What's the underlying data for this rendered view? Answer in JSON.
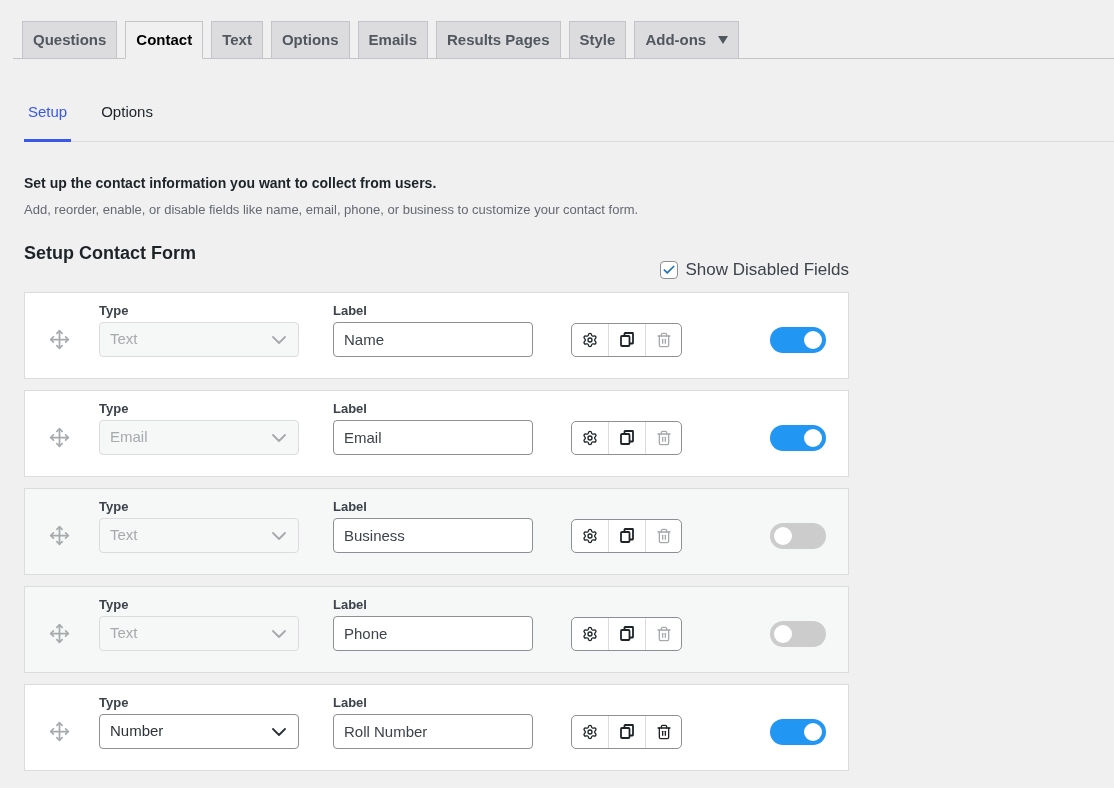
{
  "tabs": [
    {
      "label": "Questions",
      "selected": false,
      "dropdown": false
    },
    {
      "label": "Contact",
      "selected": true,
      "dropdown": false
    },
    {
      "label": "Text",
      "selected": false,
      "dropdown": false
    },
    {
      "label": "Options",
      "selected": false,
      "dropdown": false
    },
    {
      "label": "Emails",
      "selected": false,
      "dropdown": false
    },
    {
      "label": "Results Pages",
      "selected": false,
      "dropdown": false
    },
    {
      "label": "Style",
      "selected": false,
      "dropdown": false
    },
    {
      "label": "Add-ons",
      "selected": false,
      "dropdown": true
    }
  ],
  "subtabs": [
    {
      "label": "Setup",
      "selected": true
    },
    {
      "label": "Options",
      "selected": false
    }
  ],
  "intro": {
    "title": "Set up the contact information you want to collect from users.",
    "description": "Add, reorder, enable, or disable fields like name, email, phone, or business to customize your contact form."
  },
  "section": {
    "title": "Setup Contact Form",
    "show_disabled": {
      "label": "Show Disabled Fields",
      "checked": true
    }
  },
  "fields": [
    {
      "type_heading": "Type",
      "type": "Text",
      "type_disabled": true,
      "label_heading": "Label",
      "label": "Name",
      "delete_disabled": true,
      "enabled": true
    },
    {
      "type_heading": "Type",
      "type": "Email",
      "type_disabled": true,
      "label_heading": "Label",
      "label": "Email",
      "delete_disabled": true,
      "enabled": true
    },
    {
      "type_heading": "Type",
      "type": "Text",
      "type_disabled": true,
      "label_heading": "Label",
      "label": "Business",
      "delete_disabled": true,
      "enabled": false
    },
    {
      "type_heading": "Type",
      "type": "Text",
      "type_disabled": true,
      "label_heading": "Label",
      "label": "Phone",
      "delete_disabled": true,
      "enabled": false
    },
    {
      "type_heading": "Type",
      "type": "Number",
      "type_disabled": false,
      "label_heading": "Label",
      "label": "Roll Number",
      "delete_disabled": false,
      "enabled": true
    }
  ]
}
